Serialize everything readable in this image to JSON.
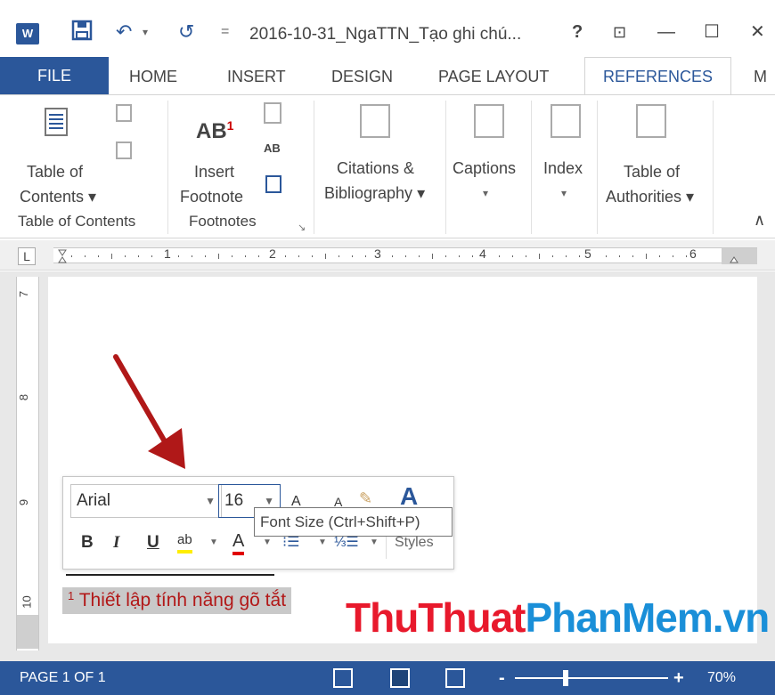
{
  "app": {
    "logo_text": "W",
    "document_title": "2016-10-31_NgaTTN_Tạo ghi chú..."
  },
  "window_controls": {
    "help": "?",
    "ribbon_display": "⊡",
    "minimize": "—",
    "maximize": "☐",
    "close": "✕"
  },
  "tabs": {
    "file": "FILE",
    "home": "HOME",
    "insert": "INSERT",
    "design": "DESIGN",
    "page_layout": "PAGE LAYOUT",
    "references": "REFERENCES",
    "mailings_cut": "M"
  },
  "ribbon": {
    "toc_line1": "Table of",
    "toc_line2": "Contents ▾",
    "insert_footnote_icon": "AB",
    "insert_footnote_sup": "1",
    "insert_footnote_line1": "Insert",
    "insert_footnote_line2": "Footnote",
    "next_footnote_icon": "AB",
    "citations_line1": "Citations &",
    "citations_line2": "Bibliography ▾",
    "captions_line1": "Captions",
    "captions_line2": "▾",
    "index_line1": "Index",
    "index_line2": "▾",
    "authorities_line1": "Table of",
    "authorities_line2": "Authorities ▾",
    "group_toc": "Table of Contents",
    "group_footnotes": "Footnotes",
    "collapse": "∧"
  },
  "ruler": {
    "tab_selector": "L",
    "numbers": [
      "1",
      "2",
      "3",
      "4",
      "5",
      "6"
    ]
  },
  "vertical_ruler": {
    "numbers": [
      "7",
      "8",
      "9",
      "10"
    ]
  },
  "document": {
    "footnote_number": "1",
    "footnote_text": " Thiết lập tính năng gõ tắt"
  },
  "mini_toolbar": {
    "font_name": "Arial",
    "font_size": "16",
    "grow_font": "A",
    "shrink_font": "A",
    "styles_icon": "A",
    "bold": "B",
    "italic": "I",
    "underline": "U",
    "highlight": "ab",
    "font_color": "A",
    "bullets": "⁝☰",
    "numbering": "⅓☰",
    "styles_label": "Styles"
  },
  "tooltip": {
    "text": "Font Size (Ctrl+Shift+P)"
  },
  "watermark": {
    "part1": "ThuThuat",
    "part2": "PhanMem.vn"
  },
  "status_bar": {
    "page_info": "PAGE 1 OF 1",
    "zoom_minus": "-",
    "zoom_plus": "+",
    "zoom_level": "70%"
  },
  "colors": {
    "accent": "#2b579a",
    "footnote_text": "#b21818",
    "watermark_red": "#e8192c",
    "watermark_blue": "#1a8fd8",
    "arrow": "#b01818"
  }
}
